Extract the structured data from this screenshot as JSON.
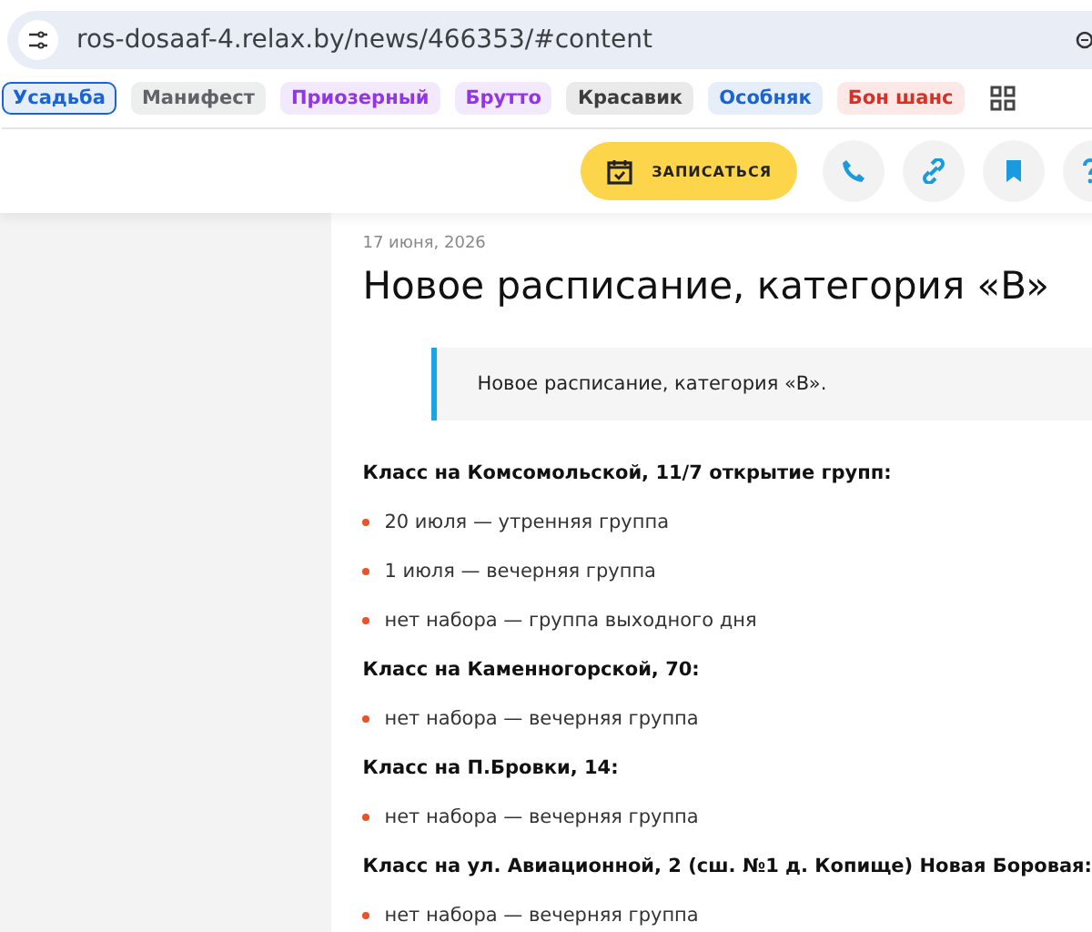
{
  "address_bar": {
    "url": "ros-dosaaf-4.relax.by/news/466353/#content"
  },
  "bookmarks": [
    {
      "label": "Усадьба",
      "selected": true,
      "color": "#1a63d6"
    },
    {
      "label": "Манифест",
      "selected": false,
      "color": "#5f6368"
    },
    {
      "label": "Приозерный",
      "selected": false,
      "color": "#9334e6"
    },
    {
      "label": "Брутто",
      "selected": false,
      "color": "#9334e6"
    },
    {
      "label": "Красавик",
      "selected": false,
      "color": "#3c3c3c"
    },
    {
      "label": "Особняк",
      "selected": false,
      "color": "#1a63d6"
    },
    {
      "label": "Бон шанс",
      "selected": false,
      "color": "#d93025"
    }
  ],
  "header": {
    "signup_button": "ЗАПИСАТЬСЯ"
  },
  "article": {
    "date": "17 июня, 2026",
    "title": "Новое расписание, категория «B»",
    "quote": "Новое расписание, категория «B».",
    "sections": [
      {
        "heading": "Класс на Комсомольской, 11/7 открытие групп:",
        "items": [
          "20 июля — утренняя группа",
          "1 июля — вечерняя группа",
          "нет набора — группа выходного дня"
        ]
      },
      {
        "heading": "Класс на Каменногорской, 70:",
        "items": [
          "нет набора — вечерняя группа"
        ]
      },
      {
        "heading": "Класс на П.Бровки, 14:",
        "items": [
          "нет набора — вечерняя группа"
        ]
      },
      {
        "heading": "Класс на ул. Авиационной, 2 (сш. №1 д. Копище) Новая Боровая:",
        "items": [
          "нет набора — вечерняя группа"
        ]
      }
    ]
  }
}
